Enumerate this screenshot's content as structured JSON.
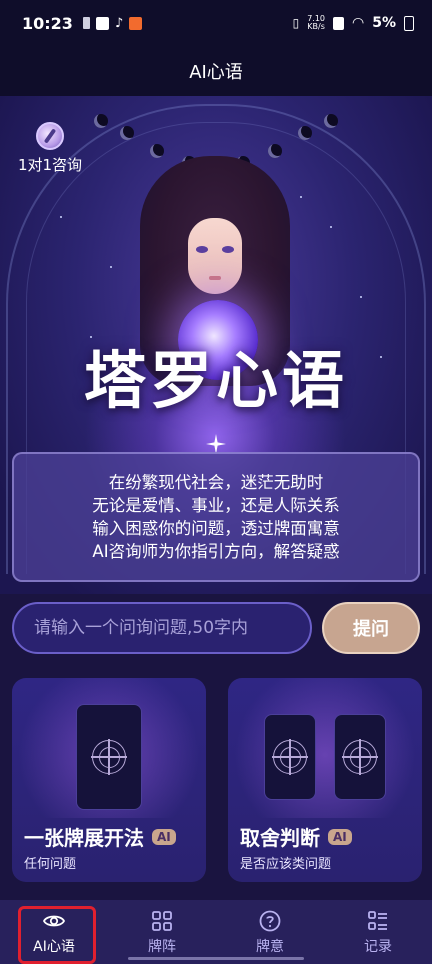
{
  "status_bar": {
    "time": "10:23",
    "net_speed": "7.10\nKB/s",
    "battery": "5%"
  },
  "header": {
    "title": "AI心语"
  },
  "hero": {
    "consult_label": "1对1咨询",
    "title": "塔罗心语",
    "description_lines": [
      "在纷繁现代社会，迷茫无助时",
      "无论是爱情、事业，还是人际关系",
      "输入困惑你的问题，透过牌面寓意",
      "AI咨询师为你指引方向，解答疑惑"
    ]
  },
  "ask": {
    "placeholder": "请输入一个问询问题,50字内",
    "button_label": "提问"
  },
  "spreads": [
    {
      "title": "一张牌展开法",
      "badge": "AI",
      "subtitle": "任何问题"
    },
    {
      "title": "取舍判断",
      "badge": "AI",
      "subtitle": "是否应该类问题"
    }
  ],
  "bottom_nav": {
    "items": [
      {
        "label": "AI心语",
        "icon": "eye-icon"
      },
      {
        "label": "牌阵",
        "icon": "grid-icon"
      },
      {
        "label": "牌意",
        "icon": "question-circle-icon"
      },
      {
        "label": "记录",
        "icon": "list-icon"
      }
    ],
    "active_index": 0
  }
}
